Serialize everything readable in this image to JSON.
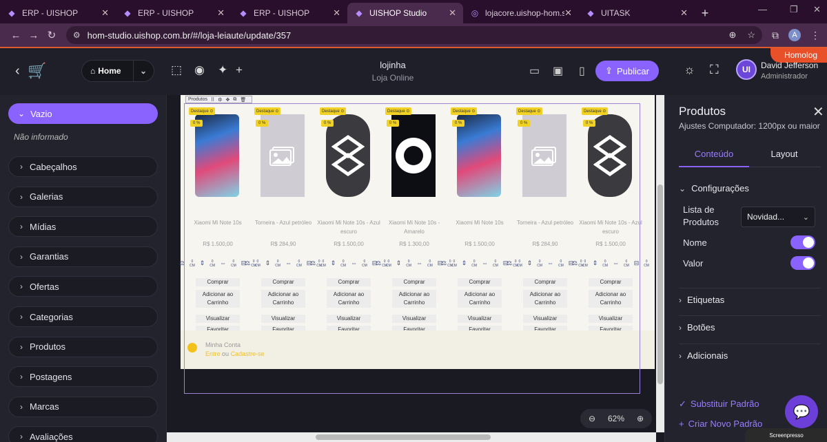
{
  "browser": {
    "tabs": [
      {
        "label": "ERP - UISHOP",
        "icon": "uishop-icon",
        "active": false
      },
      {
        "label": "ERP - UISHOP",
        "icon": "uishop-icon",
        "active": false
      },
      {
        "label": "ERP - UISHOP",
        "icon": "uishop-icon",
        "active": false
      },
      {
        "label": "UISHOP Studio",
        "icon": "uishop-icon",
        "active": true
      },
      {
        "label": "lojacore.uishop-hom.site",
        "icon": "globe-icon",
        "active": false
      },
      {
        "label": "UITASK",
        "icon": "uitask-icon",
        "active": false
      }
    ],
    "url": "hom-studio.uishop.com.br/#/loja-leiaute/update/357",
    "profile_initial": "A"
  },
  "header": {
    "env_badge": "Homolog",
    "home_label": "Home",
    "store_name": "lojinha",
    "store_subtitle": "Loja Online",
    "publish_label": "Publicar",
    "user_name": "David Jefferson",
    "user_role": "Administrador",
    "user_initials": "UI"
  },
  "left_panel": {
    "active_section": "Vazio",
    "not_informed": "Não informado",
    "sections": [
      "Cabeçalhos",
      "Galerias",
      "Mídias",
      "Garantias",
      "Ofertas",
      "Categorias",
      "Produtos",
      "Postagens",
      "Marcas",
      "Avaliações"
    ]
  },
  "canvas": {
    "toolbar_label": "Produtos",
    "products": [
      {
        "name": "Xiaomi Mi Note 10s",
        "price": "R$ 1.500,00",
        "image": "phone"
      },
      {
        "name": "Torneira - Azul petróleo",
        "price": "R$ 284,90",
        "image": "placeholder"
      },
      {
        "name": "Xiaomi Mi Note 10s - Azul escuro",
        "price": "R$ 1.500,00",
        "image": "logo"
      },
      {
        "name": "Xiaomi Mi Note 10s - Amarelo",
        "price": "R$ 1.300,00",
        "image": "circle"
      },
      {
        "name": "Xiaomi Mi Note 10s",
        "price": "R$ 1.500,00",
        "image": "phone"
      },
      {
        "name": "Torneira - Azul petróleo",
        "price": "R$ 284,90",
        "image": "placeholder"
      },
      {
        "name": "Xiaomi Mi Note 10s - Azul escuro",
        "price": "R$ 1.500,00",
        "image": "logo"
      }
    ],
    "badge_label": "Destaque",
    "discount_label": "0 %",
    "dim_value": "0",
    "dim_unit": "CM",
    "buttons": {
      "buy": "Comprar",
      "add_cart": "Adicionar ao Carrinho",
      "view": "Visualizar",
      "favorite": "Favoritar"
    },
    "account": {
      "title": "Minha Conta",
      "login": "Entre",
      "or": "ou",
      "register": "Cadastre-se"
    },
    "zoom": "62%"
  },
  "right_panel": {
    "title": "Produtos",
    "subtitle": "Ajustes Computador: 1200px ou maior",
    "tabs": [
      "Conteúdo",
      "Layout"
    ],
    "config_section": "Configurações",
    "list_label": "Lista de Produtos",
    "list_value": "Novidad...",
    "name_label": "Nome",
    "value_label": "Valor",
    "name_on": true,
    "value_on": true,
    "sections": [
      "Etiquetas",
      "Botões",
      "Adicionais"
    ],
    "replace_default": "Substituir Padrão",
    "create_default": "Criar Novo Padrão",
    "watermark": "Screenpresso"
  }
}
